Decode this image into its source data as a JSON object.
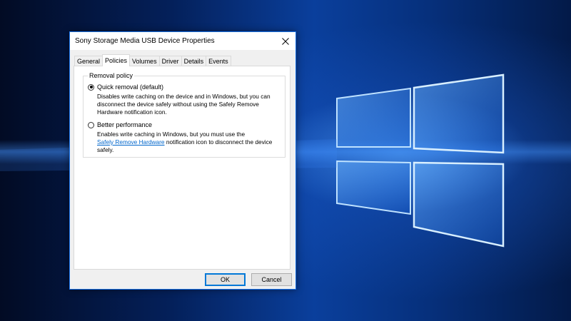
{
  "dialog": {
    "title": "Sony Storage Media USB Device Properties",
    "tabs": [
      {
        "label": "General",
        "active": false
      },
      {
        "label": "Policies",
        "active": true
      },
      {
        "label": "Volumes",
        "active": false
      },
      {
        "label": "Driver",
        "active": false
      },
      {
        "label": "Details",
        "active": false
      },
      {
        "label": "Events",
        "active": false
      }
    ],
    "removal_policy": {
      "group_label": "Removal policy",
      "quick_removal": {
        "label": "Quick removal (default)",
        "selected": true,
        "description": "Disables write caching on the device and in Windows, but you can disconnect the device safely without using the Safely Remove Hardware notification icon."
      },
      "better_performance": {
        "label": "Better performance",
        "selected": false,
        "description_before": "Enables write caching in Windows, but you must use the",
        "link_text": "Safely Remove Hardware",
        "description_after": " notification icon to disconnect the device safely."
      }
    },
    "buttons": {
      "ok": "OK",
      "cancel": "Cancel"
    }
  },
  "colors": {
    "accent": "#0078d7",
    "link": "#0066cc",
    "desktop_dark": "#03153a",
    "desktop_glow": "#3a8cff"
  }
}
